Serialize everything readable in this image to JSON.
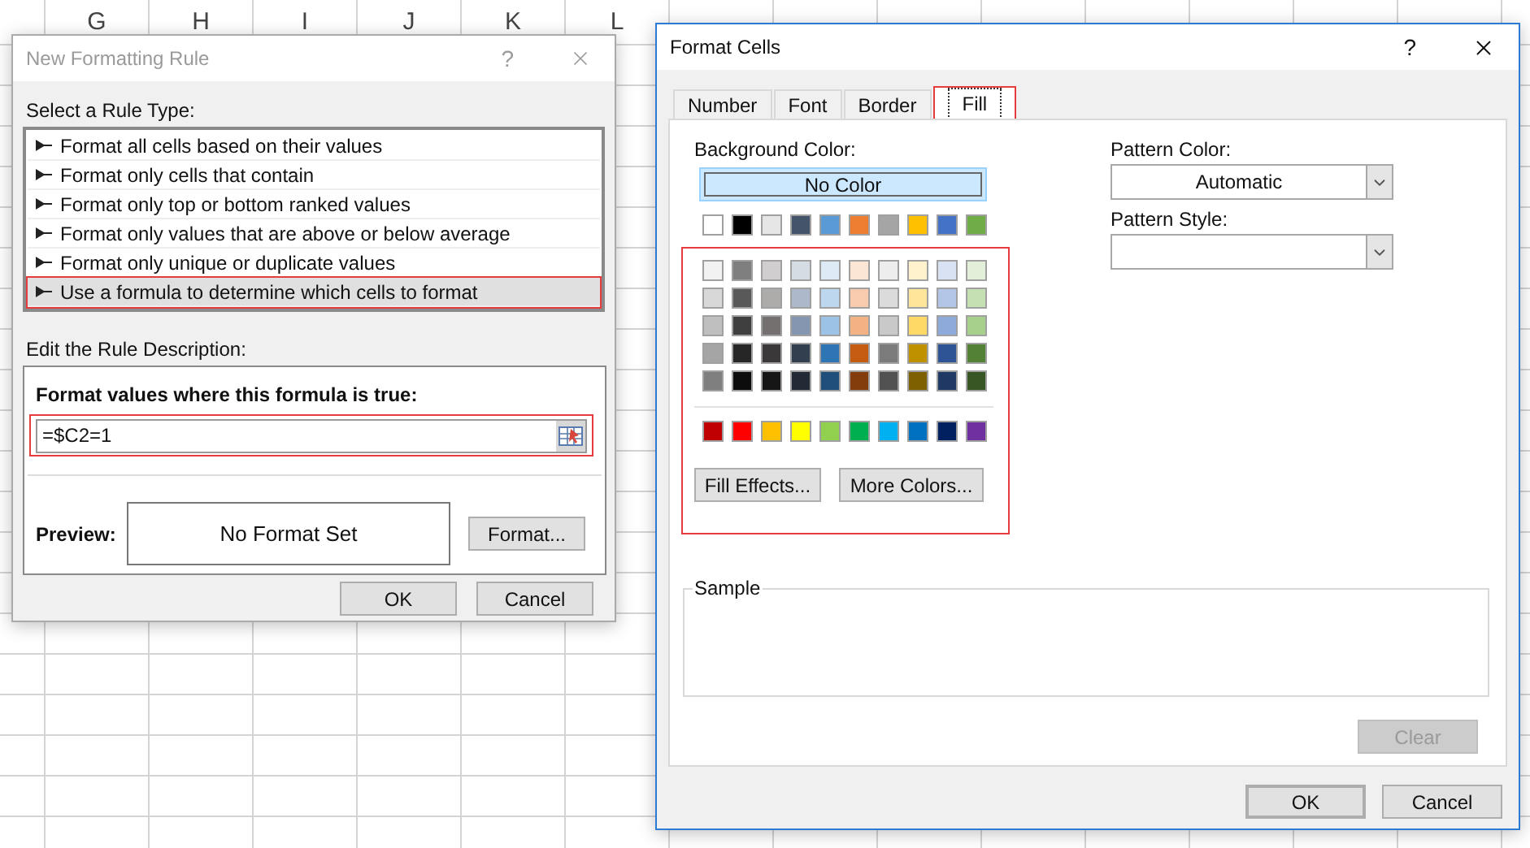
{
  "sheet": {
    "columns": [
      "G",
      "H",
      "I",
      "J",
      "K",
      "L"
    ]
  },
  "rule_dialog": {
    "title": "New Formatting Rule",
    "help": "?",
    "rule_type_label": "Select a Rule Type:",
    "rule_types": [
      {
        "label": "Format all cells based on their values",
        "selected": false
      },
      {
        "label": "Format only cells that contain",
        "selected": false
      },
      {
        "label": "Format only top or bottom ranked values",
        "selected": false
      },
      {
        "label": "Format only values that are above or below average",
        "selected": false
      },
      {
        "label": "Format only unique or duplicate values",
        "selected": false
      },
      {
        "label": "Use a formula to determine which cells to format",
        "selected": true
      }
    ],
    "description_label": "Edit the Rule Description:",
    "formula_label": "Format values where this formula is true:",
    "formula": "=$C2=1",
    "preview_label": "Preview:",
    "preview_text": "No Format Set",
    "format_button": "Format...",
    "buttons": [
      "OK",
      "Cancel"
    ]
  },
  "format_cells": {
    "title": "Format Cells",
    "help": "?",
    "tabs": [
      {
        "label": "Number",
        "selected": false
      },
      {
        "label": "Font",
        "selected": false
      },
      {
        "label": "Border",
        "selected": false
      },
      {
        "label": "Fill",
        "selected": true
      }
    ],
    "background_color_label": "Background Color:",
    "no_color_button": "No Color",
    "theme_colors": [
      {
        "color": "#ffffff"
      },
      {
        "color": "#000000"
      },
      {
        "color": "#e7e6e6"
      },
      {
        "color": "#44546a"
      },
      {
        "color": "#5b9bd5"
      },
      {
        "color": "#ed7d31"
      },
      {
        "color": "#a5a5a5"
      },
      {
        "color": "#ffc000"
      },
      {
        "color": "#4472c4"
      },
      {
        "color": "#70ad47"
      }
    ],
    "shade_rows": [
      {
        "swatches": [
          {
            "color": "#f2f2f2"
          },
          {
            "color": "#7f7f7f"
          },
          {
            "color": "#d0cece"
          },
          {
            "color": "#d6dce4"
          },
          {
            "color": "#deebf6"
          },
          {
            "color": "#fbe5d5"
          },
          {
            "color": "#ededed"
          },
          {
            "color": "#fff2cc"
          },
          {
            "color": "#d9e2f3"
          },
          {
            "color": "#e2efd9"
          }
        ]
      },
      {
        "swatches": [
          {
            "color": "#d8d8d8"
          },
          {
            "color": "#595959"
          },
          {
            "color": "#aeabab"
          },
          {
            "color": "#adb9ca"
          },
          {
            "color": "#bdd7ee"
          },
          {
            "color": "#f7cbac"
          },
          {
            "color": "#dbdbdb"
          },
          {
            "color": "#fee599"
          },
          {
            "color": "#b4c6e7"
          },
          {
            "color": "#c5e0b3"
          }
        ]
      },
      {
        "swatches": [
          {
            "color": "#bfbfbf"
          },
          {
            "color": "#3f3f3f"
          },
          {
            "color": "#757070"
          },
          {
            "color": "#8496b0"
          },
          {
            "color": "#9cc3e5"
          },
          {
            "color": "#f4b183"
          },
          {
            "color": "#c9c9c9"
          },
          {
            "color": "#ffd965"
          },
          {
            "color": "#8eaadb"
          },
          {
            "color": "#a8d08d"
          }
        ]
      },
      {
        "swatches": [
          {
            "color": "#a5a5a5"
          },
          {
            "color": "#262626"
          },
          {
            "color": "#3a3838"
          },
          {
            "color": "#323f4f"
          },
          {
            "color": "#2e75b5"
          },
          {
            "color": "#c55a11"
          },
          {
            "color": "#7b7b7b"
          },
          {
            "color": "#bf9000"
          },
          {
            "color": "#2f5496"
          },
          {
            "color": "#538135"
          }
        ]
      },
      {
        "swatches": [
          {
            "color": "#7f7f7f"
          },
          {
            "color": "#0c0c0c"
          },
          {
            "color": "#171616"
          },
          {
            "color": "#222a35"
          },
          {
            "color": "#1e4e79"
          },
          {
            "color": "#833c0b"
          },
          {
            "color": "#525252"
          },
          {
            "color": "#7f6000"
          },
          {
            "color": "#1f3864"
          },
          {
            "color": "#375623"
          }
        ]
      }
    ],
    "standard_colors": [
      {
        "color": "#c00000"
      },
      {
        "color": "#ff0000"
      },
      {
        "color": "#ffc000"
      },
      {
        "color": "#ffff00"
      },
      {
        "color": "#92d050"
      },
      {
        "color": "#00b050"
      },
      {
        "color": "#00b0f0"
      },
      {
        "color": "#0070c0"
      },
      {
        "color": "#002060"
      },
      {
        "color": "#7030a0"
      }
    ],
    "fill_effects_button": "Fill Effects...",
    "more_colors_button": "More Colors...",
    "pattern_color_label": "Pattern Color:",
    "pattern_color": "Automatic",
    "pattern_style_label": "Pattern Style:",
    "sample_label": "Sample",
    "clear_button": {
      "label": "Clear",
      "disabled": true
    },
    "buttons": [
      "OK",
      "Cancel"
    ]
  }
}
